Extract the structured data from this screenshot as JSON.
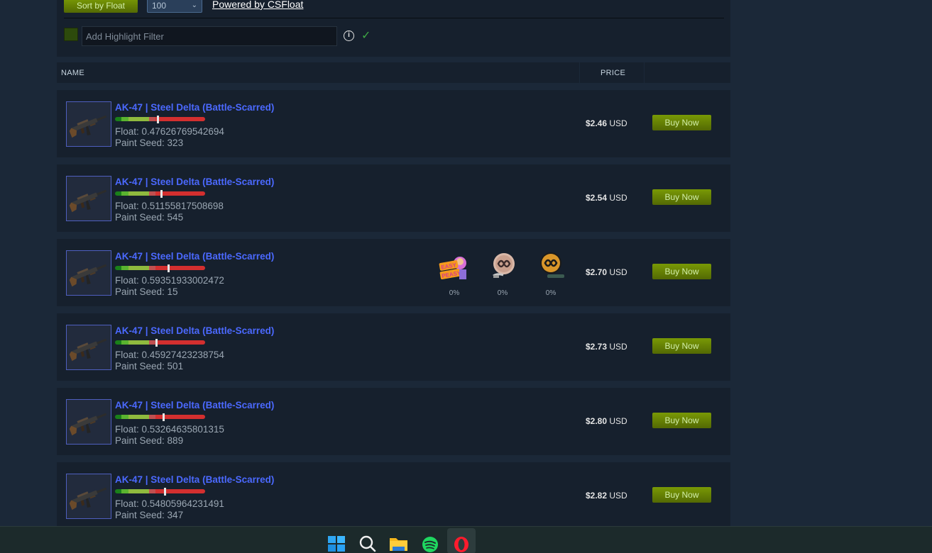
{
  "controls": {
    "sort_label": "Sort by Float",
    "count_value": "100",
    "powered_label": "Powered by CSFloat",
    "highlight_placeholder": "Add Highlight Filter",
    "info_glyph": "i",
    "check_glyph": "✓"
  },
  "header": {
    "name_label": "NAME",
    "price_label": "PRICE"
  },
  "colors": {
    "item_name": "#4b69ff",
    "buy_button": "#5c7e10",
    "wear_fn": "#1a7f1a",
    "wear_mw": "#5ab32f",
    "wear_ft": "#8fba3e",
    "wear_ww": "#c05050",
    "wear_bs": "#d32f2f"
  },
  "listings": [
    {
      "name": "AK-47 | Steel Delta (Battle-Scarred)",
      "float": "Float: 0.47626769542694",
      "seed": "Paint Seed: 323",
      "price_amount": "$2.46",
      "price_currency": "USD",
      "buy_label": "Buy Now",
      "float_value": 0.47626769542694
    },
    {
      "name": "AK-47 | Steel Delta (Battle-Scarred)",
      "float": "Float: 0.51155817508698",
      "seed": "Paint Seed: 545",
      "price_amount": "$2.54",
      "price_currency": "USD",
      "buy_label": "Buy Now",
      "float_value": 0.51155817508698
    },
    {
      "name": "AK-47 | Steel Delta (Battle-Scarred)",
      "float": "Float: 0.59351933002472",
      "seed": "Paint Seed: 15",
      "price_amount": "$2.70",
      "price_currency": "USD",
      "buy_label": "Buy Now",
      "float_value": 0.59351933002472,
      "stickers": [
        {
          "icon": "easy-peasy-sticker-icon",
          "wear": "0%"
        },
        {
          "icon": "hellraisers-sticker-icon",
          "wear": "0%"
        },
        {
          "icon": "hellraisers-gold-sticker-icon",
          "wear": "0%"
        }
      ]
    },
    {
      "name": "AK-47 | Steel Delta (Battle-Scarred)",
      "float": "Float: 0.45927423238754",
      "seed": "Paint Seed: 501",
      "price_amount": "$2.73",
      "price_currency": "USD",
      "buy_label": "Buy Now",
      "float_value": 0.45927423238754
    },
    {
      "name": "AK-47 | Steel Delta (Battle-Scarred)",
      "float": "Float: 0.53264635801315",
      "seed": "Paint Seed: 889",
      "price_amount": "$2.80",
      "price_currency": "USD",
      "buy_label": "Buy Now",
      "float_value": 0.53264635801315
    },
    {
      "name": "AK-47 | Steel Delta (Battle-Scarred)",
      "float": "Float: 0.54805964231491",
      "seed": "Paint Seed: 347",
      "price_amount": "$2.82",
      "price_currency": "USD",
      "buy_label": "Buy Now",
      "float_value": 0.54805964231491
    }
  ],
  "taskbar": {
    "icons": [
      "windows-start-icon",
      "search-icon",
      "file-explorer-icon",
      "spotify-icon",
      "opera-icon"
    ],
    "active": "opera-icon"
  }
}
